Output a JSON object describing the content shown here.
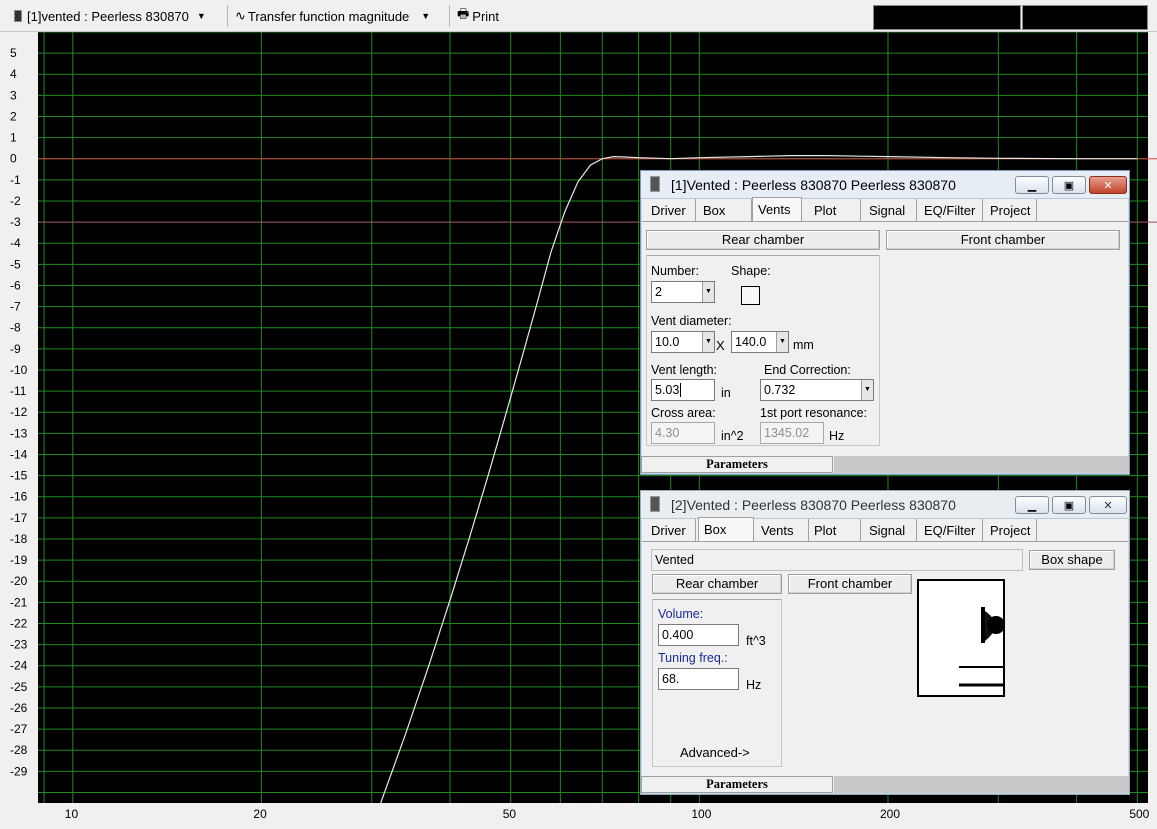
{
  "toolbar": {
    "driver_select": "[1]vented : Peerless 830870",
    "plot_select": "Transfer function magnitude",
    "print_label": "Print",
    "graph_icon": "tilde-wave-icon",
    "print_icon": "printer-icon"
  },
  "chart_data": {
    "type": "line",
    "x_scale": "log",
    "xlim": [
      8.8,
      520
    ],
    "ylim": [
      -30.5,
      6
    ],
    "x_tick_labels": [
      "10",
      "20",
      "50",
      "100",
      "200",
      "500"
    ],
    "x_tick_values": [
      10,
      20,
      50,
      100,
      200,
      500
    ],
    "y_tick_values": [
      5,
      4,
      3,
      2,
      1,
      0,
      -1,
      -2,
      -3,
      -4,
      -5,
      -6,
      -7,
      -8,
      -9,
      -10,
      -11,
      -12,
      -13,
      -14,
      -15,
      -16,
      -17,
      -18,
      -19,
      -20,
      -21,
      -22,
      -23,
      -24,
      -25,
      -26,
      -27,
      -28,
      -29
    ],
    "grid": true,
    "background_color": "#000000",
    "grid_color": "#1f8a1f",
    "reference_lines": [
      {
        "y": 0,
        "color": "#d04040"
      },
      {
        "y": -3,
        "color": "#a04070"
      }
    ],
    "series": [
      {
        "color": "#e8e8e8",
        "x": [
          31,
          34,
          37,
          40,
          43,
          46,
          49,
          52,
          55,
          58,
          61,
          64,
          67,
          70,
          73,
          76,
          80,
          90,
          100,
          120,
          140,
          160,
          180,
          200,
          250,
          300,
          400,
          500
        ],
        "y": [
          -30.5,
          -27.2,
          -24,
          -20.9,
          -17.9,
          -15,
          -12.2,
          -9.5,
          -6.9,
          -4.4,
          -2.5,
          -1.1,
          -0.3,
          0,
          0.1,
          0.08,
          0.05,
          0,
          0.05,
          0.1,
          0.15,
          0.15,
          0.12,
          0.1,
          0.05,
          0.02,
          0,
          0
        ]
      }
    ]
  },
  "win1": {
    "title": "[1]Vented : Peerless 830870 Peerless 830870",
    "tabs": [
      "Driver",
      "Box",
      "Vents",
      "Plot",
      "Signal",
      "EQ/Filter",
      "Project"
    ],
    "rear_chamber": "Rear chamber",
    "front_chamber": "Front chamber",
    "number_label": "Number:",
    "number_value": "2",
    "shape_label": "Shape:",
    "vent_diameter_label": "Vent diameter:",
    "diam_w": "10.0",
    "diam_x": "X",
    "diam_h": "140.0",
    "diam_unit": "mm",
    "vent_length_label": "Vent length:",
    "vent_length_value": "5.03",
    "vent_length_unit": "in",
    "end_corr_label": "End Correction:",
    "end_corr_value": "0.732",
    "cross_area_label": "Cross area:",
    "cross_area_value": "4.30",
    "cross_area_unit": "in^2",
    "port_res_label": "1st port resonance:",
    "port_res_value": "1345.02",
    "port_res_unit": "Hz",
    "status": "Parameters"
  },
  "win2": {
    "title": "[2]Vented : Peerless 830870 Peerless 830870",
    "tabs": [
      "Driver",
      "Box",
      "Vents",
      "Plot",
      "Signal",
      "EQ/Filter",
      "Project"
    ],
    "box_type": "Vented",
    "box_shape_btn": "Box shape",
    "rear_chamber": "Rear chamber",
    "front_chamber": "Front chamber",
    "volume_label": "Volume:",
    "volume_value": "0.400",
    "volume_unit": "ft^3",
    "tuning_label": "Tuning freq.:",
    "tuning_value": "68.",
    "tuning_unit": "Hz",
    "advanced": "Advanced->",
    "status": "Parameters"
  }
}
